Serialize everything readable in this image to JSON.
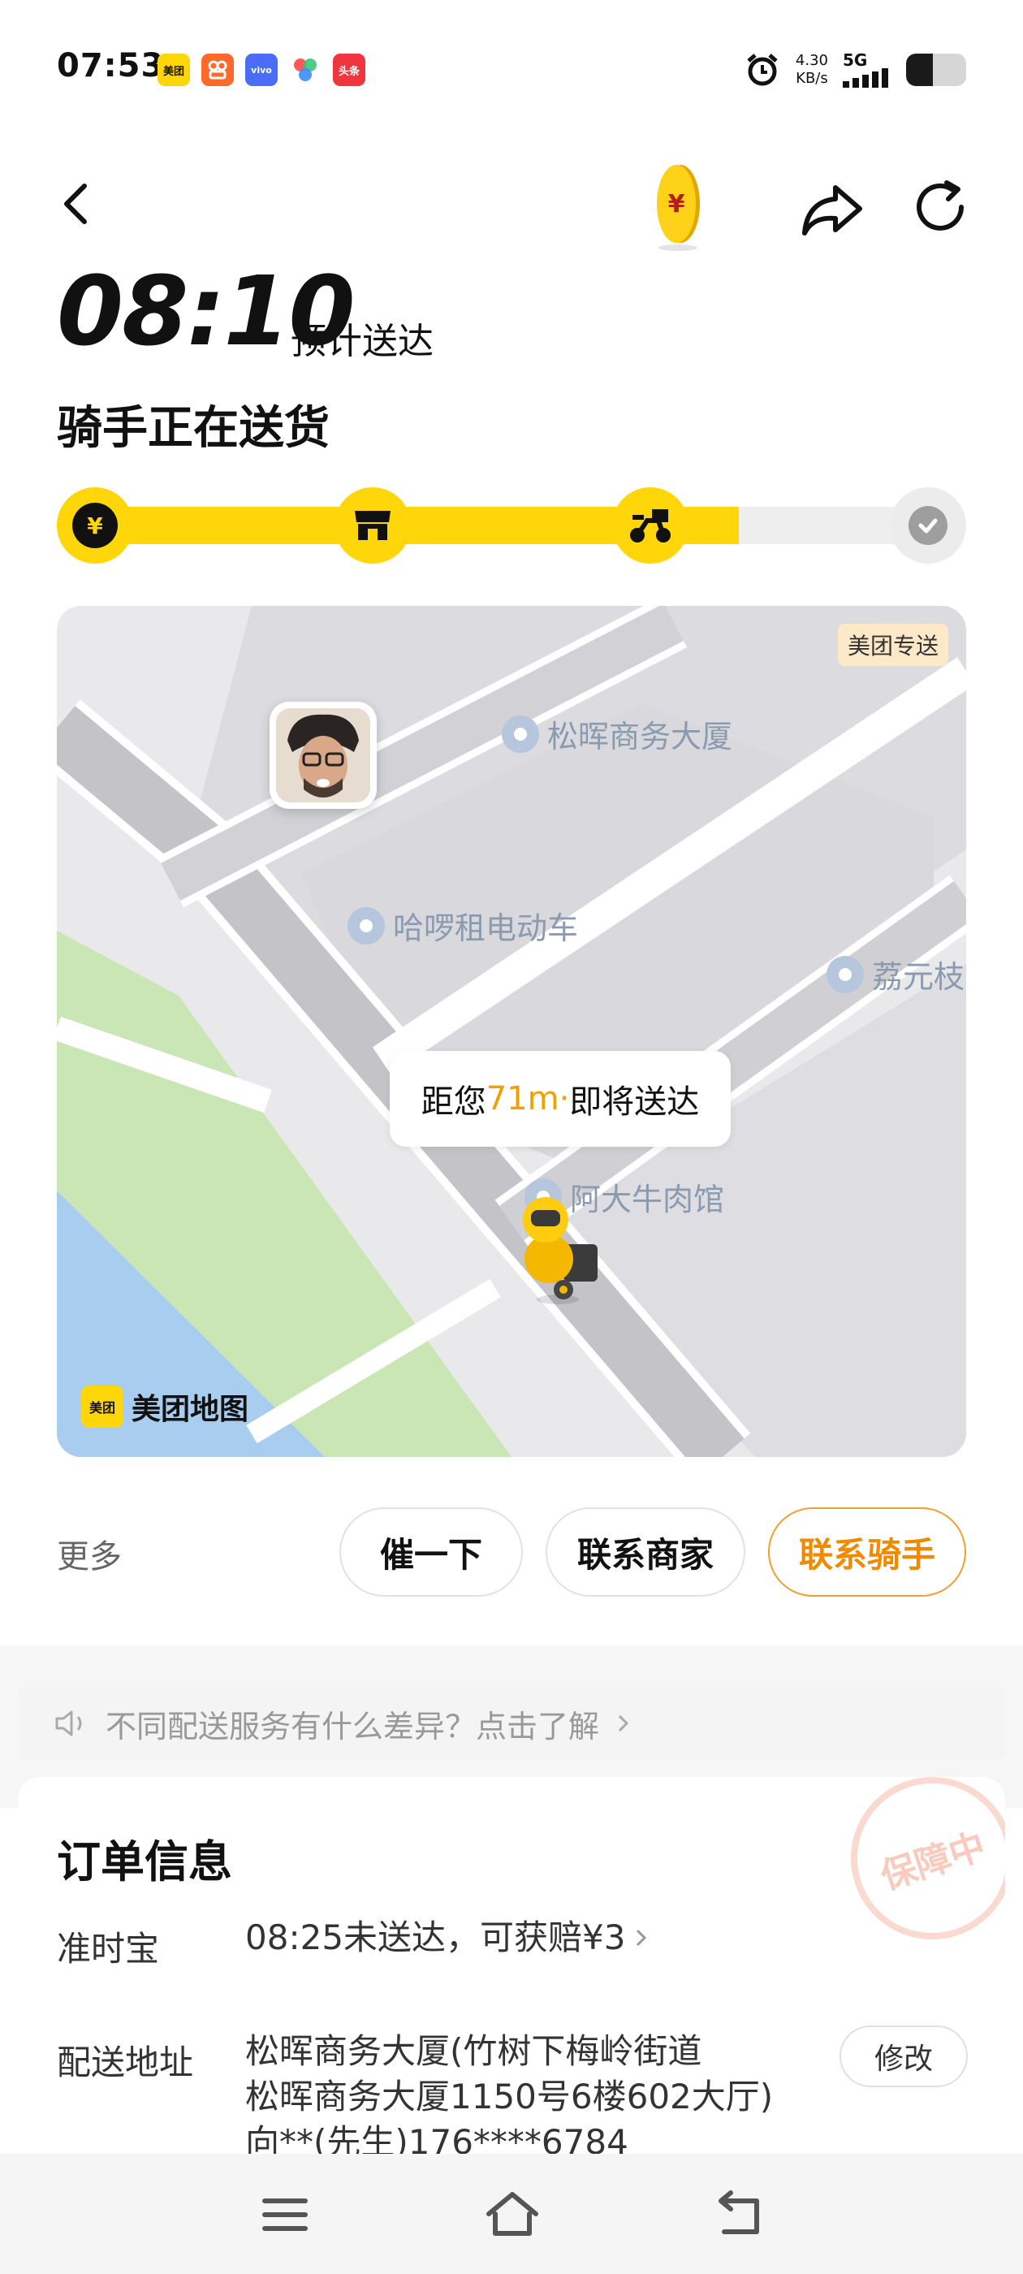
{
  "status_bar": {
    "time": "07:53",
    "apps": [
      {
        "name": "meituan-app-icon",
        "label": "美团",
        "color": "#ffd60a"
      },
      {
        "name": "kuaishou-app-icon",
        "label": "",
        "color": "#ff6a2b"
      },
      {
        "name": "vivo-app-icon",
        "label": "vivo",
        "color": "#4a6cf7"
      },
      {
        "name": "colorful-app-icon",
        "label": "",
        "color": "#ffffff"
      },
      {
        "name": "toutiao-app-icon",
        "label": "头条",
        "color": "#f0353f"
      }
    ],
    "net_speed_value": "4.30",
    "net_speed_unit": "KB/s",
    "network": "5G",
    "battery_level": 0.45
  },
  "header": {
    "eta_time": "08:10",
    "eta_label": "预计送达",
    "rider_status": "骑手正在送货"
  },
  "progress": {
    "fill_fraction": 0.75,
    "steps": [
      {
        "name": "paid",
        "state": "done"
      },
      {
        "name": "store",
        "state": "done"
      },
      {
        "name": "delivering",
        "state": "done"
      },
      {
        "name": "delivered",
        "state": "todo"
      }
    ]
  },
  "map": {
    "badge": "美团专送",
    "pois": {
      "building": "松晖商务大厦",
      "scooter": "哈啰租电动车",
      "right_poi": "荔元枝",
      "restaurant": "阿大牛肉馆"
    },
    "distance_prefix": "距您",
    "distance_value": "71m",
    "distance_suffix": "·即将送达",
    "logo_mark": "美团",
    "logo_text": "美团地图"
  },
  "actions": {
    "more": "更多",
    "urge": "催一下",
    "contact_merchant": "联系商家",
    "contact_rider": "联系骑手"
  },
  "tip": {
    "text": "不同配送服务有什么差异？点击了解"
  },
  "order": {
    "title": "订单信息",
    "stamp": "保障中",
    "ontime_label": "准时宝",
    "ontime_value": "08:25未送达，可获赔¥3",
    "address_label": "配送地址",
    "address_line1": "松晖商务大厦(竹树下梅岭街道",
    "address_line2": "松晖商务大厦1150号6楼602大厅)",
    "address_line3": "向**(先生)176****6784",
    "modify": "修改"
  },
  "colors": {
    "accent": "#ffd60a",
    "rider_orange": "#f08a00",
    "poi_text": "#8a9bb0"
  }
}
